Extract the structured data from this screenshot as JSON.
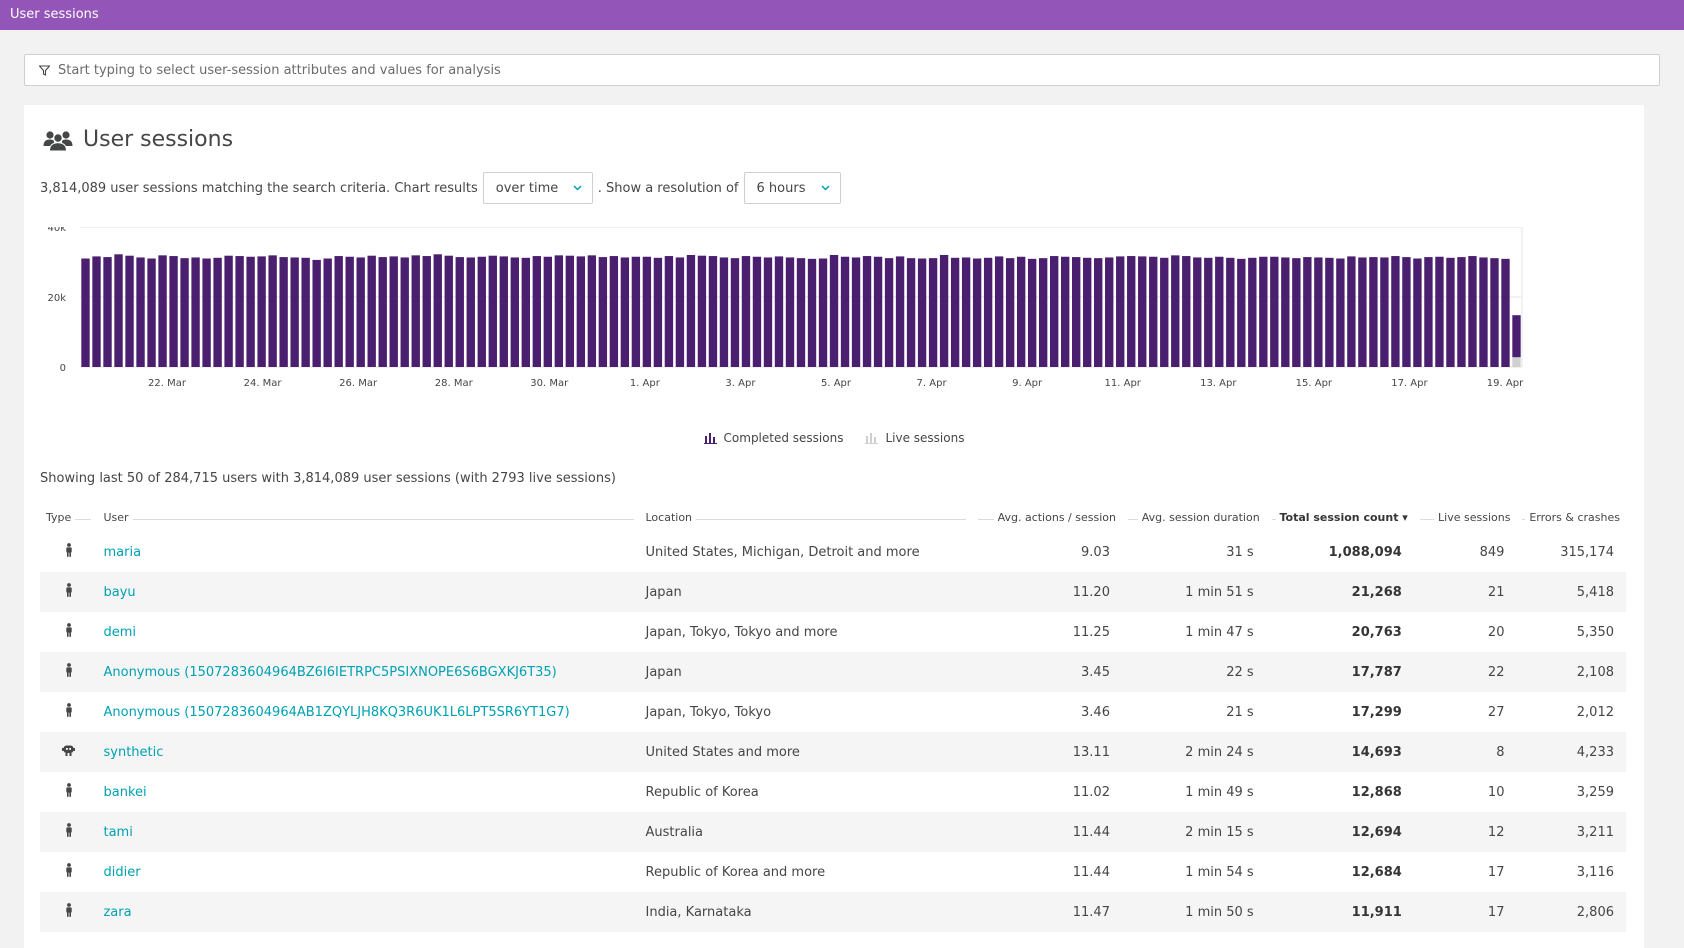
{
  "topbar": {
    "title": "User sessions"
  },
  "filter": {
    "placeholder": "Start typing to select user-session attributes and values for analysis"
  },
  "panel": {
    "title": "User sessions",
    "summary_prefix": "3,814,089 user sessions matching the search criteria. Chart results",
    "chart_mode": "over time",
    "summary_middle": ". Show a resolution of",
    "resolution": "6 hours"
  },
  "chart_data": {
    "type": "bar",
    "ylim": [
      0,
      40000
    ],
    "yticks": [
      "0",
      "20k",
      "40k"
    ],
    "xticks": [
      "22. Mar",
      "24. Mar",
      "26. Mar",
      "28. Mar",
      "30. Mar",
      "1. Apr",
      "3. Apr",
      "5. Apr",
      "7. Apr",
      "9. Apr",
      "11. Apr",
      "13. Apr",
      "15. Apr",
      "17. Apr",
      "19. Apr"
    ],
    "series": [
      {
        "name": "Completed sessions",
        "color": "#4b1f6f",
        "values": [
          31000,
          31600,
          31400,
          32200,
          31800,
          31300,
          31000,
          31900,
          31700,
          31100,
          31300,
          31000,
          31200,
          31800,
          31700,
          31500,
          31600,
          31900,
          31400,
          31300,
          31200,
          30600,
          31000,
          31700,
          31500,
          31300,
          31800,
          31400,
          31600,
          31300,
          31900,
          31700,
          32200,
          31800,
          31400,
          31300,
          31500,
          31800,
          31600,
          31300,
          31200,
          31700,
          31500,
          31900,
          31800,
          31600,
          31900,
          31400,
          31700,
          31300,
          31500,
          31500,
          31200,
          31700,
          31300,
          32000,
          31800,
          31700,
          31300,
          31100,
          31700,
          31500,
          31300,
          31600,
          31300,
          31100,
          30900,
          31000,
          32000,
          31500,
          31300,
          31700,
          31500,
          31100,
          31600,
          31100,
          31000,
          31100,
          32000,
          31200,
          31300,
          31000,
          31200,
          31600,
          31100,
          31500,
          30900,
          31100,
          31700,
          31500,
          31400,
          31200,
          31100,
          31300,
          31600,
          31700,
          31600,
          31500,
          31200,
          31900,
          31700,
          31300,
          31200,
          31500,
          31200,
          30900,
          31200,
          31500,
          31500,
          31300,
          31100,
          31400,
          31300,
          31200,
          31000,
          31600,
          31300,
          31400,
          31300,
          31700,
          31400,
          31000,
          31400,
          31500,
          31200,
          31400,
          31700,
          31300,
          31100,
          30900,
          12000
        ]
      },
      {
        "name": "Live sessions",
        "color": "#d0d0d0",
        "values": [
          0,
          0,
          0,
          0,
          0,
          0,
          0,
          0,
          0,
          0,
          0,
          0,
          0,
          0,
          0,
          0,
          0,
          0,
          0,
          0,
          0,
          0,
          0,
          0,
          0,
          0,
          0,
          0,
          0,
          0,
          0,
          0,
          0,
          0,
          0,
          0,
          0,
          0,
          0,
          0,
          0,
          0,
          0,
          0,
          0,
          0,
          0,
          0,
          0,
          0,
          0,
          0,
          0,
          0,
          0,
          0,
          0,
          0,
          0,
          0,
          0,
          0,
          0,
          0,
          0,
          0,
          0,
          0,
          0,
          0,
          0,
          0,
          0,
          0,
          0,
          0,
          0,
          0,
          0,
          0,
          0,
          0,
          0,
          0,
          0,
          0,
          0,
          0,
          0,
          0,
          0,
          0,
          0,
          0,
          0,
          0,
          0,
          0,
          0,
          0,
          0,
          0,
          0,
          0,
          0,
          0,
          0,
          0,
          0,
          0,
          0,
          0,
          0,
          0,
          0,
          0,
          0,
          0,
          0,
          0,
          0,
          0,
          0,
          0,
          0,
          0,
          0,
          0,
          0,
          0,
          2800
        ]
      }
    ],
    "grid": true,
    "legend_position": "bottom-center"
  },
  "legend": {
    "completed": "Completed sessions",
    "live": "Live sessions"
  },
  "showing": "Showing last 50 of 284,715 users with 3,814,089 user sessions (with 2793 live sessions)",
  "table": {
    "headers": {
      "type": "Type",
      "user": "User",
      "location": "Location",
      "avg_actions": "Avg. actions / session",
      "avg_duration": "Avg. session duration",
      "total": "Total session count ▾",
      "live": "Live sessions",
      "errors": "Errors & crashes"
    },
    "rows": [
      {
        "type_icon": "person-icon",
        "user": "maria",
        "location": "United States, Michigan, Detroit and more",
        "avg_actions": "9.03",
        "avg_duration": "31 s",
        "total": "1,088,094",
        "live": "849",
        "errors": "315,174"
      },
      {
        "type_icon": "person-icon",
        "user": "bayu",
        "location": "Japan",
        "avg_actions": "11.20",
        "avg_duration": "1 min 51 s",
        "total": "21,268",
        "live": "21",
        "errors": "5,418"
      },
      {
        "type_icon": "person-icon",
        "user": "demi",
        "location": "Japan, Tokyo, Tokyo and more",
        "avg_actions": "11.25",
        "avg_duration": "1 min 47 s",
        "total": "20,763",
        "live": "20",
        "errors": "5,350"
      },
      {
        "type_icon": "person-icon",
        "user": "Anonymous (1507283604964BZ6I6IETRPC5PSIXNOPE6S6BGXKJ6T35)",
        "location": "Japan",
        "avg_actions": "3.45",
        "avg_duration": "22 s",
        "total": "17,787",
        "live": "22",
        "errors": "2,108"
      },
      {
        "type_icon": "person-icon",
        "user": "Anonymous (1507283604964AB1ZQYLJH8KQ3R6UK1L6LPT5SR6YT1G7)",
        "location": "Japan, Tokyo, Tokyo",
        "avg_actions": "3.46",
        "avg_duration": "21 s",
        "total": "17,299",
        "live": "27",
        "errors": "2,012"
      },
      {
        "type_icon": "robot-icon",
        "user": "synthetic",
        "location": "United States and more",
        "avg_actions": "13.11",
        "avg_duration": "2 min 24 s",
        "total": "14,693",
        "live": "8",
        "errors": "4,233"
      },
      {
        "type_icon": "person-icon",
        "user": "bankei",
        "location": "Republic of Korea",
        "avg_actions": "11.02",
        "avg_duration": "1 min 49 s",
        "total": "12,868",
        "live": "10",
        "errors": "3,259"
      },
      {
        "type_icon": "person-icon",
        "user": "tami",
        "location": "Australia",
        "avg_actions": "11.44",
        "avg_duration": "2 min 15 s",
        "total": "12,694",
        "live": "12",
        "errors": "3,211"
      },
      {
        "type_icon": "person-icon",
        "user": "didier",
        "location": "Republic of Korea and more",
        "avg_actions": "11.44",
        "avg_duration": "1 min 54 s",
        "total": "12,684",
        "live": "17",
        "errors": "3,116"
      },
      {
        "type_icon": "person-icon",
        "user": "zara",
        "location": "India, Karnataka",
        "avg_actions": "11.47",
        "avg_duration": "1 min 50 s",
        "total": "11,911",
        "live": "17",
        "errors": "2,806"
      }
    ]
  }
}
